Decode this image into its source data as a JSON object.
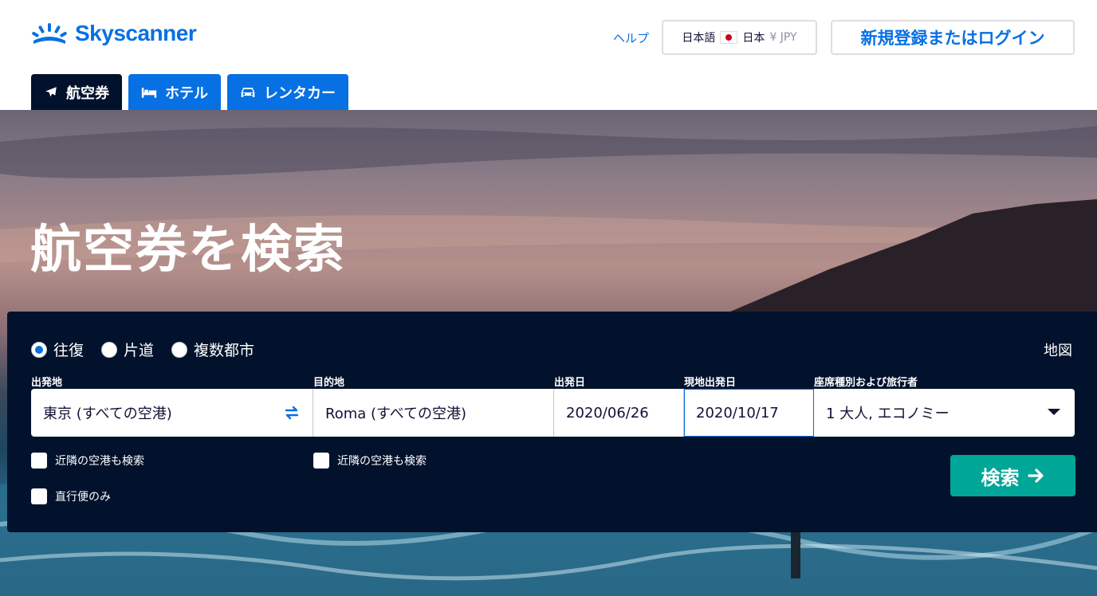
{
  "brand": {
    "name": "Skyscanner",
    "color": "#0770e3"
  },
  "header": {
    "help": "ヘルプ",
    "locale": {
      "language": "日本語",
      "country": "日本",
      "currency": "¥ JPY"
    },
    "login": "新規登録またはログイン"
  },
  "tabs": [
    {
      "label": "航空券",
      "icon": "airplane-icon",
      "active": true
    },
    {
      "label": "ホテル",
      "icon": "bed-icon",
      "active": false
    },
    {
      "label": "レンタカー",
      "icon": "car-icon",
      "active": false
    }
  ],
  "hero": {
    "title": "航空券を検索"
  },
  "search": {
    "trip_types": [
      {
        "label": "往復",
        "selected": true
      },
      {
        "label": "片道",
        "selected": false
      },
      {
        "label": "複数都市",
        "selected": false
      }
    ],
    "map": "地図",
    "labels": {
      "origin": "出発地",
      "destination": "目的地",
      "depart": "出発日",
      "return": "現地出発日",
      "cabin": "座席種別および旅行者"
    },
    "values": {
      "origin": "東京 (すべての空港)",
      "destination": "Roma (すべての空港)",
      "depart": "2020/06/26",
      "return": "2020/10/17",
      "cabin": "1 大人, エコノミー"
    },
    "nearby_origin": "近隣の空港も検索",
    "nearby_destination": "近隣の空港も検索",
    "direct_only": "直行便のみ",
    "submit": "検索"
  },
  "colors": {
    "navy": "#02122c",
    "accent": "#0770e3",
    "search_button": "#00a698"
  }
}
